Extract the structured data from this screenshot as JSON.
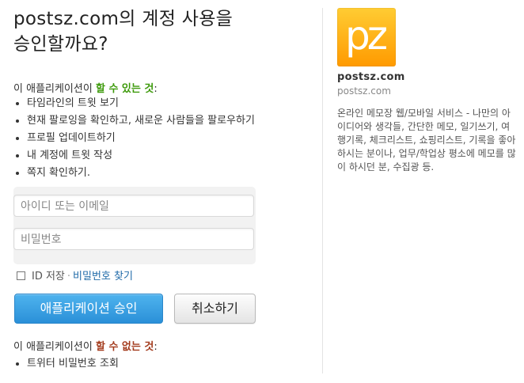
{
  "header": {
    "title_line1": "postsz.com의 계정 사용을",
    "title_line2": "승인할까요?"
  },
  "permissions": {
    "heading_prefix": "이 애플리케이션이 ",
    "heading_highlight": "할 수 있는 것",
    "heading_suffix": ":",
    "items": [
      "타임라인의 트윗 보기",
      "현재 팔로잉을 확인하고, 새로운 사람들을 팔로우하기",
      "프로필 업데이트하기",
      "내 계정에 트윗 작성",
      "쪽지 확인하기."
    ]
  },
  "login": {
    "username_placeholder": "아이디 또는 이메일",
    "password_placeholder": "비밀번호",
    "remember_label": "ID 저장",
    "separator": "·",
    "forgot_password_link": "비밀번호 찾기"
  },
  "buttons": {
    "approve_label": "애플리케이션 승인",
    "cancel_label": "취소하기"
  },
  "restrictions": {
    "heading_prefix": "이 애플리케이션이 ",
    "heading_highlight": "할 수 없는 것",
    "heading_suffix": ":",
    "items": [
      "트위터 비밀번호 조회"
    ]
  },
  "app_info": {
    "logo_text": "pz",
    "name": "postsz.com",
    "organization": "postsz.com",
    "description": "온라인 메모장 웹/모바일 서비스 - 나만의 아이디어와 생각들, 간단한 메모, 일기쓰기, 여행기록, 체크리스트, 쇼핑리스트, 기록을 좋아하시는 분이나, 업무/학업상 평소에 메모를 많이 하시던 분, 수집광 등."
  },
  "colors": {
    "can_highlight": "#3d9a0b",
    "cannot_highlight": "#a33b1d",
    "link": "#1f6aa8",
    "primary_button": "#2a90d8",
    "logo_background": "#ff9a00"
  }
}
